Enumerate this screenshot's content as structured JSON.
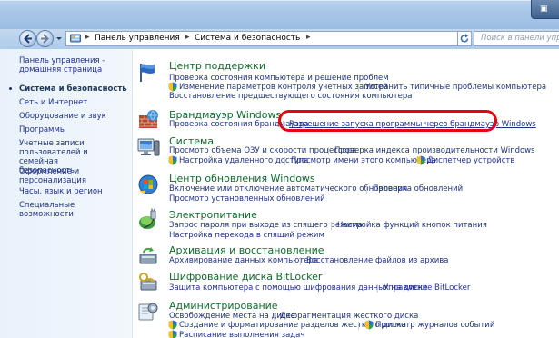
{
  "window": {
    "caption_glyph": "▣"
  },
  "navbar": {
    "crumbs": [
      "Панель управления",
      "Система и безопасность"
    ],
    "search_placeholder": "Поиск в панели управления"
  },
  "leftpane": {
    "home": [
      "Панель управления -",
      "домашняя страница"
    ],
    "items": [
      {
        "label": "Система и безопасность",
        "current": true
      },
      {
        "label": "Сеть и Интернет"
      },
      {
        "label": "Оборудование и звук"
      },
      {
        "label": "Программы"
      },
      {
        "label": [
          "Учетные записи",
          "пользователей и семейная",
          "безопасность"
        ]
      },
      {
        "label": [
          "Оформление и",
          "персонализация"
        ]
      },
      {
        "label": "Часы, язык и регион"
      },
      {
        "label": "Специальные возможности"
      }
    ]
  },
  "categories": {
    "support": {
      "title": "Центр поддержки",
      "links": [
        "Проверка состояния компьютера и решение проблем",
        "Изменение параметров контроля учетных записей",
        "Устранить типичные проблемы компьютера",
        "Восстановление предшествующего состояния компьютера"
      ]
    },
    "firewall": {
      "title": "Брандмауэр Windows",
      "links": [
        "Проверка состояния брандмауэра",
        "Разрешение запуска программы через брандмауэр Windows"
      ]
    },
    "system": {
      "title": "Система",
      "links": [
        "Просмотр объема ОЗУ и скорости процессора",
        "Проверка индекса производительности Windows",
        "Настройка удаленного доступа",
        "Просмотр имени этого компьютера",
        "Диспетчер устройств"
      ]
    },
    "update": {
      "title": "Центр обновления Windows",
      "links": [
        "Включение или отключение автоматического обновления",
        "Проверка обновлений",
        "Просмотр установленных обновлений"
      ]
    },
    "power": {
      "title": "Электропитание",
      "links": [
        "Запрос пароля при выходе из спящего режима",
        "Настройка функций кнопок питания",
        "Настройка перехода в спящий режим"
      ]
    },
    "backup": {
      "title": "Архивация и восстановление",
      "links": [
        "Архивирование данных компьютера",
        "Восстановление файлов из архива"
      ]
    },
    "bitlocker": {
      "title": "Шифрование диска BitLocker",
      "links": [
        "Защита компьютера с помощью шифрования данных на диске",
        "Управление BitLocker"
      ]
    },
    "admin": {
      "title": "Администрирование",
      "links": [
        "Освобождение места на диске",
        "Дефрагментация жесткого диска",
        "Создание и форматирование разделов жесткого диска",
        "Просмотр журналов событий",
        "Расписание выполнения задач"
      ]
    }
  },
  "colors": {
    "title_green": "#0f6b2c",
    "link_blue": "#1e3287",
    "highlight_red": "#e30612"
  }
}
